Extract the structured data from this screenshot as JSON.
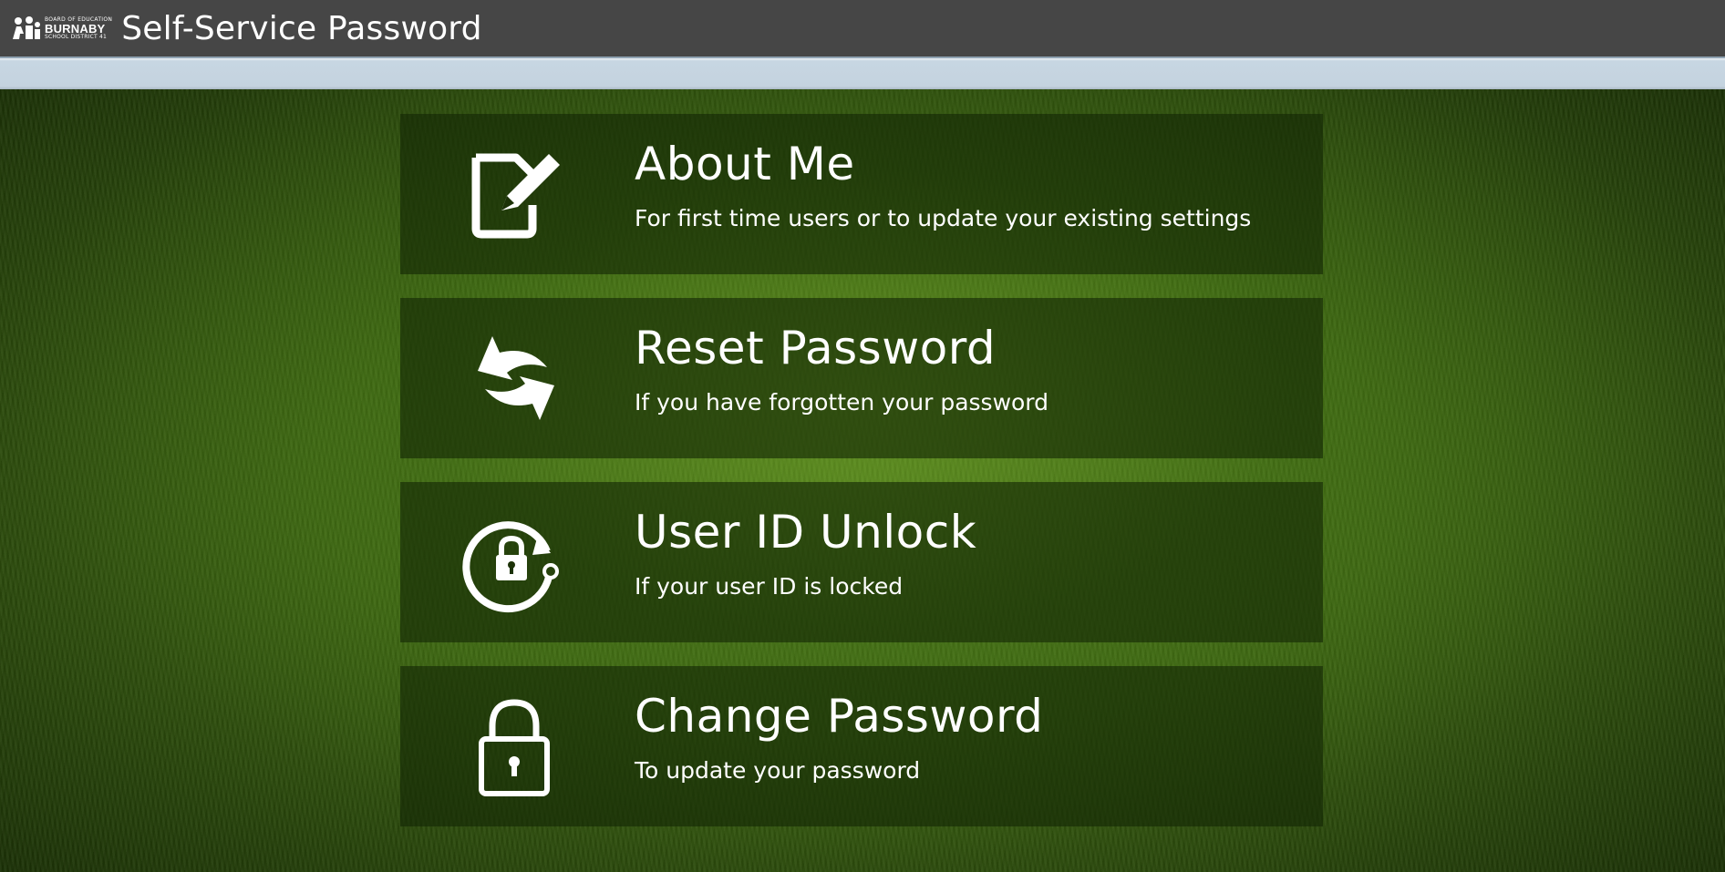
{
  "header": {
    "logo": {
      "line1": "BOARD OF EDUCATION",
      "line2": "BURNABY",
      "line3": "SCHOOL DISTRICT 41"
    },
    "title": "Self-Service Password"
  },
  "tiles": [
    {
      "title": "About Me",
      "description": "For first time users or to update your existing settings",
      "icon": "edit-document-icon"
    },
    {
      "title": "Reset Password",
      "description": "If you have forgotten your password",
      "icon": "reset-arrows-icon"
    },
    {
      "title": "User ID Unlock",
      "description": "If your user ID is locked",
      "icon": "unlock-cycle-icon"
    },
    {
      "title": "Change Password",
      "description": "To update your password",
      "icon": "padlock-icon"
    }
  ],
  "colors": {
    "header_bg": "#464646",
    "subbar_bg": "#c4d3df",
    "tile_bg": "rgba(20,38,5,0.62)",
    "grass": "#3d6612",
    "text": "#ffffff"
  }
}
